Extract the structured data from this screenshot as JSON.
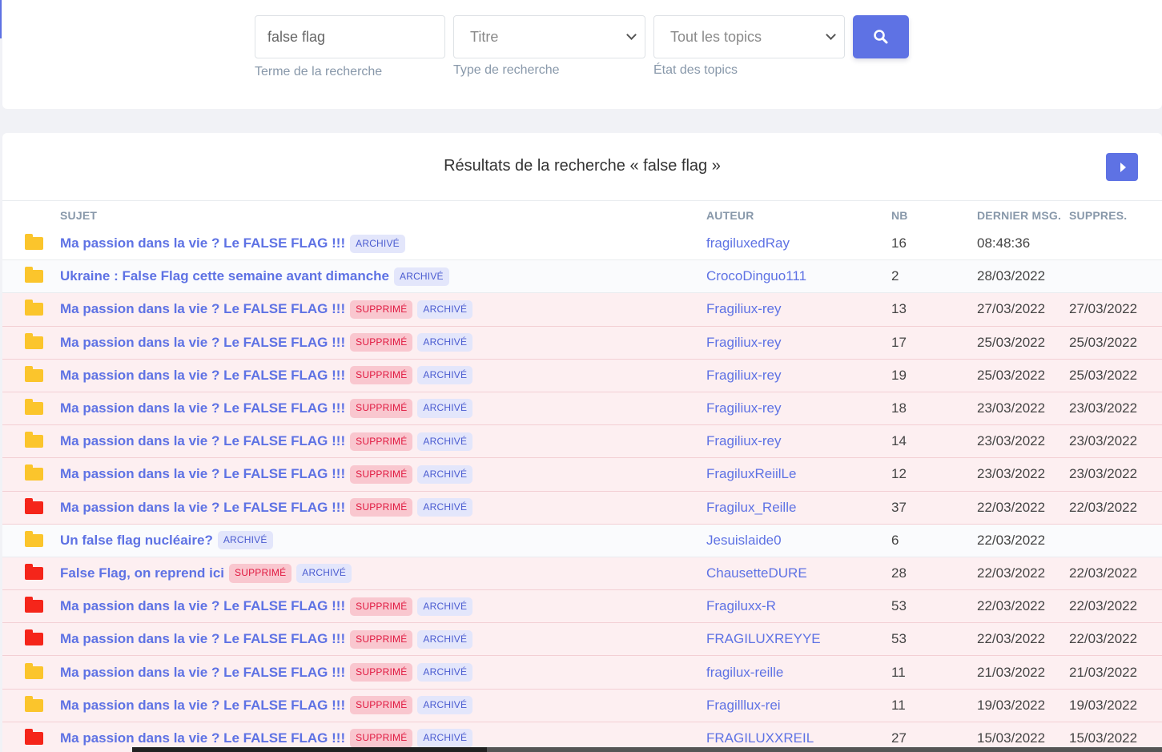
{
  "search": {
    "term_value": "false flag",
    "term_help": "Terme de la recherche",
    "type_value": "Titre",
    "type_help": "Type de recherche",
    "state_value": "Tout les topics",
    "state_help": "État des topics",
    "button_icon": "search-icon"
  },
  "results": {
    "title": "Résultats de la recherche « false flag »",
    "next_icon": "caret-right-icon",
    "columns": {
      "subject": "Sujet",
      "author": "Auteur",
      "nb": "NB",
      "last_msg": "Dernier msg.",
      "deleted": "Suppres."
    },
    "badges": {
      "deleted": "SUPPRIMÉ",
      "archived": "ARCHIVÉ"
    },
    "rows": [
      {
        "folder": "yellow",
        "subject": "Ma passion dans la vie ? Le FALSE FLAG !!!",
        "deleted": false,
        "archived": true,
        "author": "fragiluxedRay",
        "nb": "16",
        "last": "08:48:36",
        "supp": ""
      },
      {
        "folder": "yellow",
        "subject": "Ukraine : False Flag cette semaine avant dimanche",
        "deleted": false,
        "archived": true,
        "author": "CrocoDinguo111",
        "nb": "2",
        "last": "28/03/2022",
        "supp": ""
      },
      {
        "folder": "yellow",
        "subject": "Ma passion dans la vie ? Le FALSE FLAG !!!",
        "deleted": true,
        "archived": true,
        "author": "Fragiliux-rey",
        "nb": "13",
        "last": "27/03/2022",
        "supp": "27/03/2022"
      },
      {
        "folder": "yellow",
        "subject": "Ma passion dans la vie ? Le FALSE FLAG !!!",
        "deleted": true,
        "archived": true,
        "author": "Fragiliux-rey",
        "nb": "17",
        "last": "25/03/2022",
        "supp": "25/03/2022"
      },
      {
        "folder": "yellow",
        "subject": "Ma passion dans la vie ? Le FALSE FLAG !!!",
        "deleted": true,
        "archived": true,
        "author": "Fragiliux-rey",
        "nb": "19",
        "last": "25/03/2022",
        "supp": "25/03/2022"
      },
      {
        "folder": "yellow",
        "subject": "Ma passion dans la vie ? Le FALSE FLAG !!!",
        "deleted": true,
        "archived": true,
        "author": "Fragiliux-rey",
        "nb": "18",
        "last": "23/03/2022",
        "supp": "23/03/2022"
      },
      {
        "folder": "yellow",
        "subject": "Ma passion dans la vie ? Le FALSE FLAG !!!",
        "deleted": true,
        "archived": true,
        "author": "Fragiliux-rey",
        "nb": "14",
        "last": "23/03/2022",
        "supp": "23/03/2022"
      },
      {
        "folder": "yellow",
        "subject": "Ma passion dans la vie ? Le FALSE FLAG !!!",
        "deleted": true,
        "archived": true,
        "author": "FragiluxReiilLe",
        "nb": "12",
        "last": "23/03/2022",
        "supp": "23/03/2022"
      },
      {
        "folder": "red",
        "subject": "Ma passion dans la vie ? Le FALSE FLAG !!!",
        "deleted": true,
        "archived": true,
        "author": "Fragilux_Reille",
        "nb": "37",
        "last": "22/03/2022",
        "supp": "22/03/2022"
      },
      {
        "folder": "yellow",
        "subject": "Un false flag nucléaire?",
        "deleted": false,
        "archived": true,
        "author": "Jesuislaide0",
        "nb": "6",
        "last": "22/03/2022",
        "supp": ""
      },
      {
        "folder": "red",
        "subject": "False Flag, on reprend ici",
        "deleted": true,
        "archived": true,
        "author": "ChausetteDURE",
        "nb": "28",
        "last": "22/03/2022",
        "supp": "22/03/2022"
      },
      {
        "folder": "red",
        "subject": "Ma passion dans la vie ? Le FALSE FLAG !!!",
        "deleted": true,
        "archived": true,
        "author": "Fragiluxx-R",
        "nb": "53",
        "last": "22/03/2022",
        "supp": "22/03/2022"
      },
      {
        "folder": "red",
        "subject": "Ma passion dans la vie ? Le FALSE FLAG !!!",
        "deleted": true,
        "archived": true,
        "author": "FRAGILUXREYYE",
        "nb": "53",
        "last": "22/03/2022",
        "supp": "22/03/2022"
      },
      {
        "folder": "yellow",
        "subject": "Ma passion dans la vie ? Le FALSE FLAG !!!",
        "deleted": true,
        "archived": true,
        "author": "fragilux-reille",
        "nb": "11",
        "last": "21/03/2022",
        "supp": "21/03/2022"
      },
      {
        "folder": "yellow",
        "subject": "Ma passion dans la vie ? Le FALSE FLAG !!!",
        "deleted": true,
        "archived": true,
        "author": "Fragilllux-rei",
        "nb": "11",
        "last": "19/03/2022",
        "supp": "19/03/2022"
      },
      {
        "folder": "red",
        "subject": "Ma passion dans la vie ? Le FALSE FLAG !!!",
        "deleted": true,
        "archived": true,
        "author": "FRAGILUXXREIL",
        "nb": "27",
        "last": "15/03/2022",
        "supp": "15/03/2022"
      }
    ]
  },
  "colors": {
    "accent": "#5e72e4",
    "folder_yellow": "#fbc52c",
    "folder_red": "#f5251a",
    "deleted_row_bg": "#fdeff1"
  }
}
